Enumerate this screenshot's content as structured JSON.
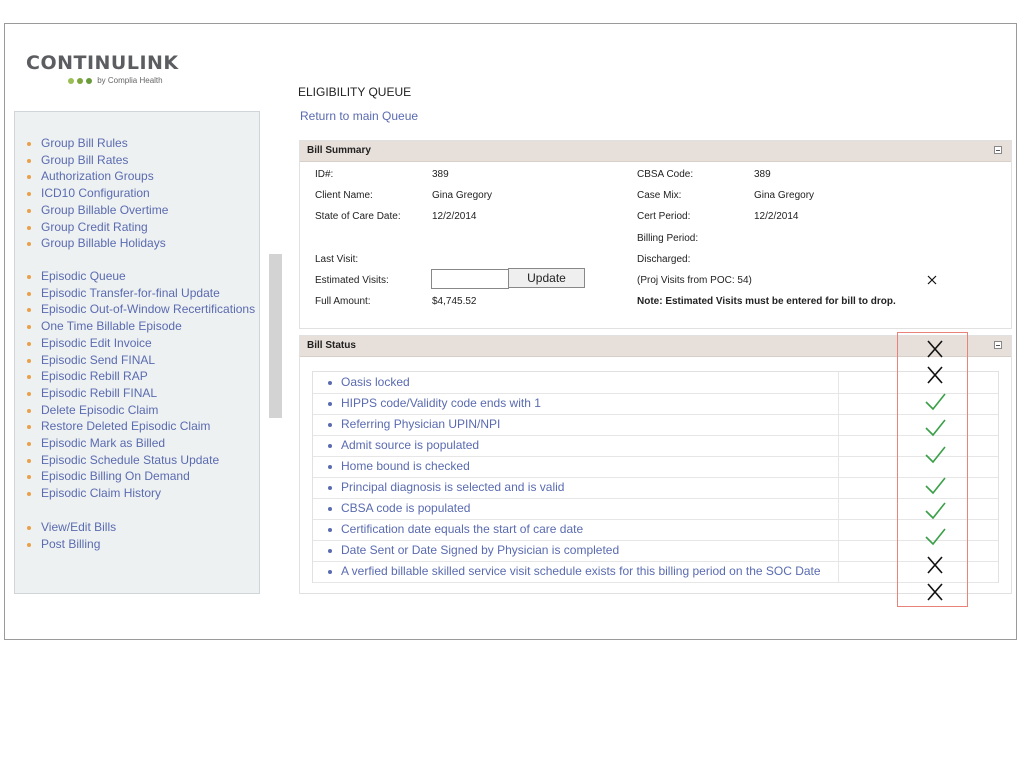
{
  "logo": {
    "name": "CONTINULINK",
    "tagline": "by Complia Health",
    "dot_colors": [
      "#9bbf55",
      "#7ea63e",
      "#6a9b3a"
    ]
  },
  "sidebar": {
    "group1": [
      "Group Bill Rules",
      "Group Bill Rates",
      "Authorization Groups",
      "ICD10 Configuration",
      "Group Billable Overtime",
      "Group Credit Rating",
      "Group Billable Holidays"
    ],
    "group2": [
      "Episodic Queue",
      "Episodic Transfer-for-final Update",
      "Episodic Out-of-Window Recertifications",
      "One Time Billable Episode",
      "Episodic Edit Invoice",
      "Episodic Send FINAL",
      "Episodic Rebill RAP",
      "Episodic Rebill FINAL",
      "Delete Episodic Claim",
      "Restore Deleted Episodic Claim",
      "Episodic Mark as Billed",
      "Episodic Schedule Status Update",
      "Episodic Billing On Demand",
      "Episodic Claim History"
    ],
    "group3": [
      "View/Edit Bills",
      "Post Billing"
    ]
  },
  "page": {
    "title": "ELIGIBILITY QUEUE",
    "return_link": "Return to main Queue"
  },
  "bill_summary": {
    "header": "Bill Summary",
    "id_label": "ID#:",
    "id_value": "389",
    "client_label": "Client Name:",
    "client_value": "Gina Gregory",
    "soc_label": "State of Care Date:",
    "soc_value": "12/2/2014",
    "last_visit_label": "Last Visit:",
    "est_visits_label": "Estimated Visits:",
    "est_visits_value": "",
    "update_label": "Update",
    "full_amount_label": "Full Amount:",
    "full_amount_value": "$4,745.52",
    "cbsa_label": "CBSA Code:",
    "cbsa_value": "389",
    "case_mix_label": "Case Mix:",
    "case_mix_value": "Gina Gregory",
    "cert_label": "Cert Period:",
    "cert_value": "12/2/2014",
    "billing_label": "Billing Period:",
    "discharged_label": "Discharged:",
    "proj_visits": "(Proj Visits from POC: 54)",
    "note": "Note: Estimated Visits must be entered for bill to drop."
  },
  "bill_status": {
    "header": "Bill Status",
    "items": [
      "Oasis locked",
      "HIPPS code/Validity code ends with 1",
      "Referring Physician UPIN/NPI",
      "Admit source is populated",
      "Home bound is checked",
      "Principal diagnosis is selected and is valid",
      "CBSA code is populated",
      "Certification date equals the start of care date",
      "Date Sent or Date Signed by Physician is completed",
      "A verfied billable skilled service visit schedule exists for this billing period on the SOC Date"
    ],
    "marks": [
      "x",
      "x",
      "check",
      "check",
      "check",
      "check",
      "check",
      "check",
      "x",
      "x"
    ],
    "check_color": "#3aa048",
    "x_color": "#111111",
    "highlight_color": "#e9837a"
  }
}
